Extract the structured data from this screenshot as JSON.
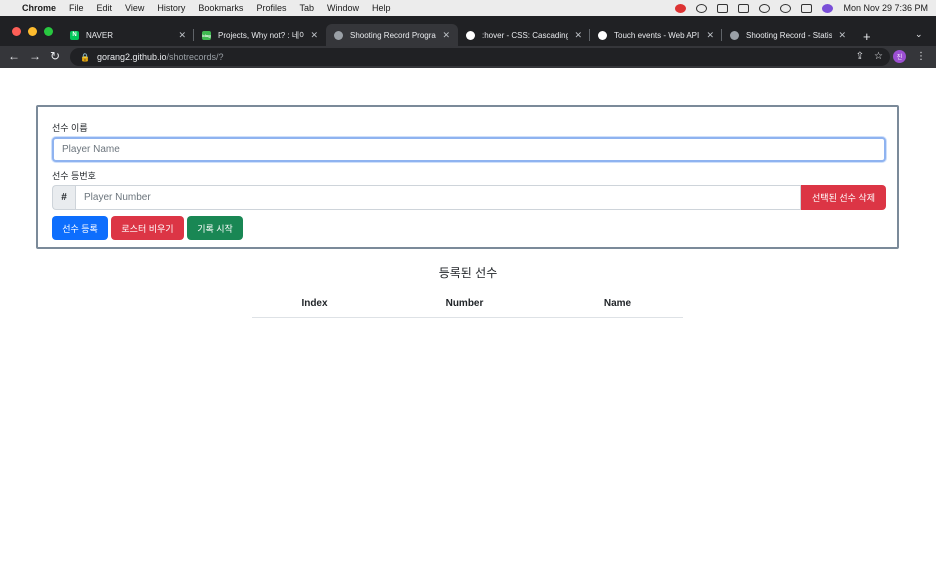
{
  "menubar": {
    "app": "Chrome",
    "items": [
      "File",
      "Edit",
      "View",
      "History",
      "Bookmarks",
      "Profiles",
      "Tab",
      "Window",
      "Help"
    ],
    "datetime": "Mon Nov 29  7:36 PM"
  },
  "tabs": [
    {
      "title": "NAVER",
      "favicon_color": "#03c75a",
      "favicon_glyph": "N"
    },
    {
      "title": "Projects, Why not? : 네이",
      "favicon_color": "#3fb950",
      "favicon_glyph": "blog"
    },
    {
      "title": "Shooting Record Progra",
      "favicon_color": "#9aa0a6",
      "favicon_glyph": ""
    },
    {
      "title": ":hover - CSS: Cascading",
      "favicon_color": "#000000",
      "favicon_glyph": ""
    },
    {
      "title": "Touch events - Web API",
      "favicon_color": "#000000",
      "favicon_glyph": ""
    },
    {
      "title": "Shooting Record - Statis",
      "favicon_color": "#9aa0a6",
      "favicon_glyph": ""
    }
  ],
  "address": {
    "host": "gorang2.github.io",
    "path": "/shotrecords/?"
  },
  "profile_initial": "진",
  "form": {
    "name_label": "선수 이름",
    "name_placeholder": "Player Name",
    "number_label": "선수 등번호",
    "number_addon": "#",
    "number_placeholder": "Player Number",
    "delete_selected_label": "선택된 선수 삭제",
    "register_label": "선수 등록",
    "clear_roster_label": "로스터 비우기",
    "start_record_label": "기록 시작"
  },
  "roster": {
    "title": "등록된 선수",
    "columns": [
      "Index",
      "Number",
      "Name"
    ],
    "rows": []
  },
  "colors": {
    "primary": "#0d6efd",
    "danger": "#dc3545",
    "success": "#198754"
  }
}
